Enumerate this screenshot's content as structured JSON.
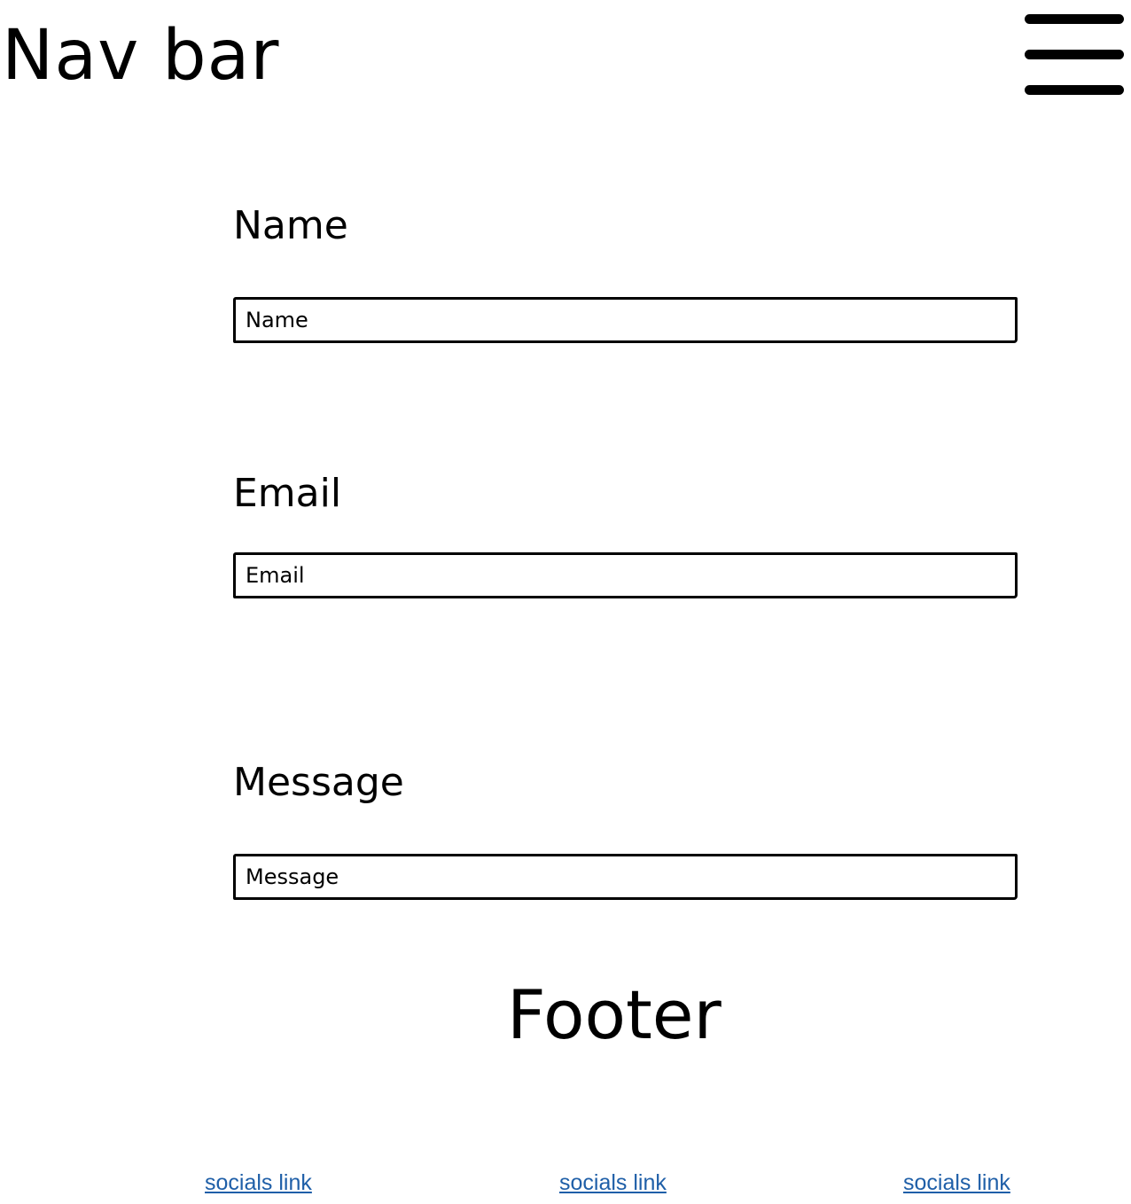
{
  "nav": {
    "title": "Nav bar",
    "menu_icon": "hamburger-menu-icon"
  },
  "form": {
    "name": {
      "label": "Name",
      "placeholder": "Name"
    },
    "email": {
      "label": "Email",
      "placeholder": "Email"
    },
    "message": {
      "label": "Message",
      "placeholder": "Message"
    }
  },
  "footer": {
    "title": "Footer",
    "links": [
      {
        "label": "socials link"
      },
      {
        "label": "socials link"
      },
      {
        "label": "socials link"
      }
    ],
    "link_color": "#1f5fa8"
  }
}
